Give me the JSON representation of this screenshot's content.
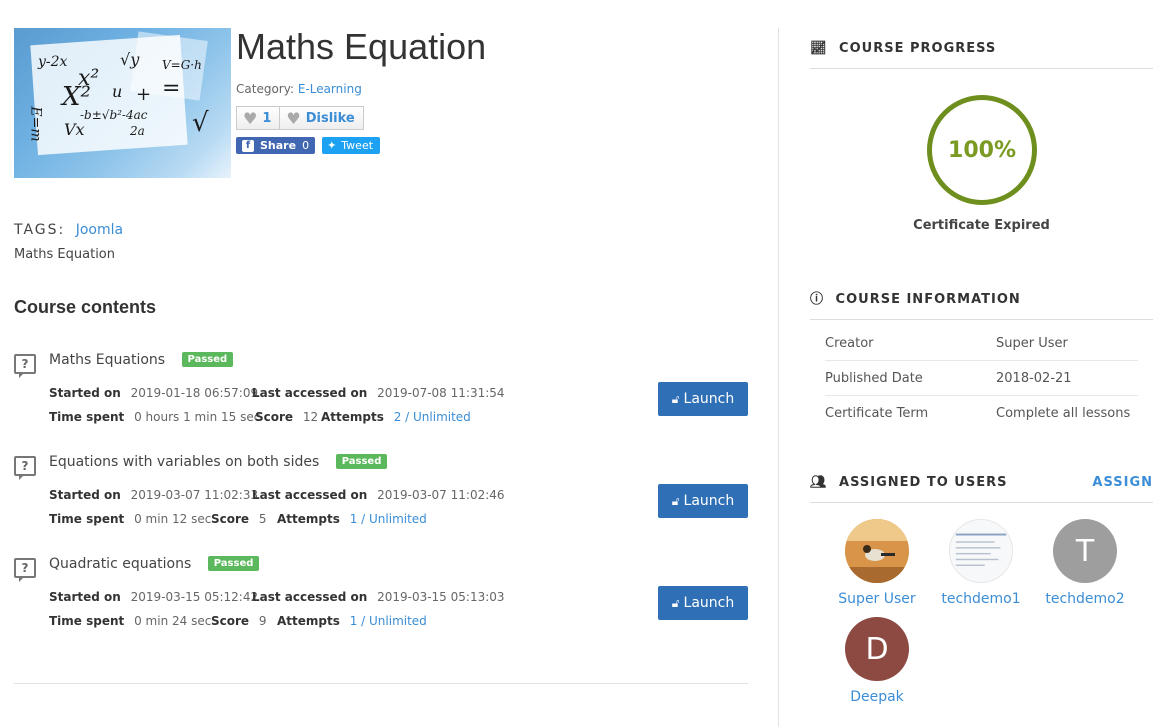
{
  "course": {
    "title": "Maths Equation",
    "category_label": "Category:",
    "category_value": "E-Learning",
    "like_count": "1",
    "dislike_label": "Dislike",
    "share_label": "Share",
    "share_count": "0",
    "tweet_label": "Tweet"
  },
  "image_text": [
    "y-2x",
    "x²",
    "√y",
    "V=G·h",
    "X²",
    "u",
    "+",
    "=",
    "-b±√b²-4ac",
    "2a",
    "E=m",
    "Vx",
    "√"
  ],
  "tags": {
    "label": "TAGS:",
    "items": [
      "Joomla"
    ],
    "subtitle": "Maths Equation"
  },
  "contents": {
    "heading": "Course contents",
    "lessons": [
      {
        "name": "Maths Equations",
        "status": "Passed",
        "started_label": "Started on",
        "started": "2019-01-18 06:57:09",
        "last_label": "Last accessed on",
        "last": "2019-07-08 11:31:54",
        "time_label": "Time spent",
        "time": "0 hours 1 min 15 sec",
        "score_label": "Score",
        "score": "12",
        "attempts_label": "Attempts",
        "attempts": "2 / Unlimited",
        "launch": "Launch"
      },
      {
        "name": "Equations with variables on both sides",
        "status": "Passed",
        "started_label": "Started on",
        "started": "2019-03-07 11:02:33",
        "last_label": "Last accessed on",
        "last": "2019-03-07 11:02:46",
        "time_label": "Time spent",
        "time": "0 min 12 sec",
        "score_label": "Score",
        "score": "5",
        "attempts_label": "Attempts",
        "attempts": "1 / Unlimited",
        "launch": "Launch"
      },
      {
        "name": "Quadratic equations",
        "status": "Passed",
        "started_label": "Started on",
        "started": "2019-03-15 05:12:42",
        "last_label": "Last accessed on",
        "last": "2019-03-15 05:13:03",
        "time_label": "Time spent",
        "time": "0 min 24 sec",
        "score_label": "Score",
        "score": "9",
        "attempts_label": "Attempts",
        "attempts": "1 / Unlimited",
        "launch": "Launch"
      }
    ]
  },
  "progress": {
    "heading": "COURSE PROGRESS",
    "percent": "100%",
    "certificate": "Certificate Expired",
    "ring_color": "#6e8f1d"
  },
  "info": {
    "heading": "COURSE INFORMATION",
    "rows": [
      {
        "key": "Creator",
        "value": "Super User"
      },
      {
        "key": "Published Date",
        "value": "2018-02-21"
      },
      {
        "key": "Certificate Term",
        "value": "Complete all lessons"
      }
    ]
  },
  "users": {
    "heading": "ASSIGNED TO USERS",
    "assign_label": "ASSIGN",
    "list": [
      {
        "name": "Super User",
        "initial": ""
      },
      {
        "name": "techdemo1",
        "initial": ""
      },
      {
        "name": "techdemo2",
        "initial": "T"
      },
      {
        "name": "Deepak",
        "initial": "D"
      }
    ]
  },
  "colors": {
    "accent": "#3b8dd6",
    "launch": "#2e6fb5",
    "passed": "#5cb85c"
  }
}
